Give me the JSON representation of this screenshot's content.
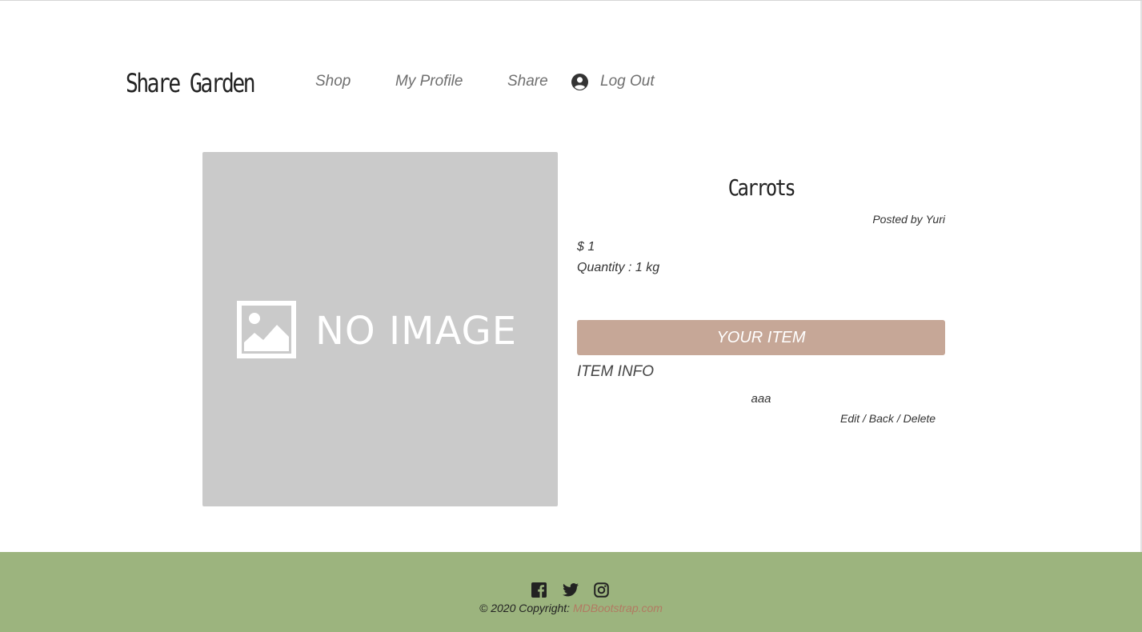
{
  "navbar": {
    "brand": "Share Garden",
    "links": {
      "shop": "Shop",
      "profile": "My Profile",
      "share": "Share",
      "logout": "Log Out"
    },
    "icons": {
      "logout": "user-circle-icon"
    }
  },
  "item": {
    "image_placeholder": "NO IMAGE",
    "title": "Carrots",
    "posted_by_label": "Posted by",
    "posted_by_user": "Yuri",
    "price": "$ 1",
    "quantity": "Quantity : 1 kg",
    "status_button": "YOUR ITEM",
    "info_heading": "ITEM INFO",
    "description": "aaa",
    "actions": {
      "edit": "Edit",
      "back": "Back",
      "delete": "Delete"
    }
  },
  "footer": {
    "copyright_prefix": "© 2020 Copyright:",
    "copyright_link": "MDBootstrap.com",
    "social": [
      "facebook-icon",
      "twitter-icon",
      "instagram-icon"
    ]
  },
  "colors": {
    "button": "#c6a797",
    "footer": "#9cb47e",
    "image_bg": "#cacaca",
    "link": "#b27a62"
  }
}
